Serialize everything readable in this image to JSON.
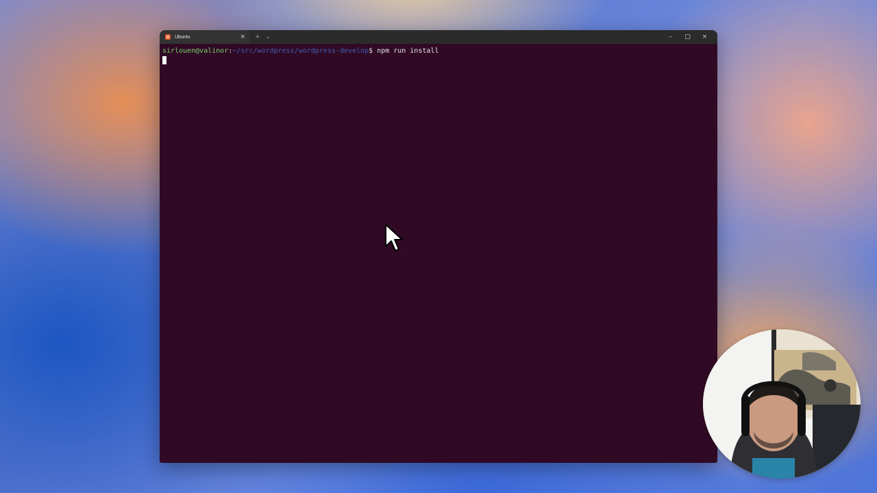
{
  "terminal": {
    "tab_title": "Ubuntu",
    "tab_close": "×",
    "new_tab": "+",
    "tab_dropdown": "⌄",
    "controls": {
      "minimize": "–",
      "maximize": "□",
      "close": "×"
    },
    "prompt_user": "sirlouen@valinor",
    "prompt_sep": ":",
    "prompt_path": "~/src/wordpress/wordpress-develop",
    "prompt_sign": "$",
    "command": "npm run install",
    "background_color": "#300a24"
  },
  "webcam": {
    "type": "presenter-webcam-overlay"
  },
  "icons": {
    "tab_icon": "ubuntu-logo-icon",
    "pointer": "mouse-pointer-icon"
  }
}
